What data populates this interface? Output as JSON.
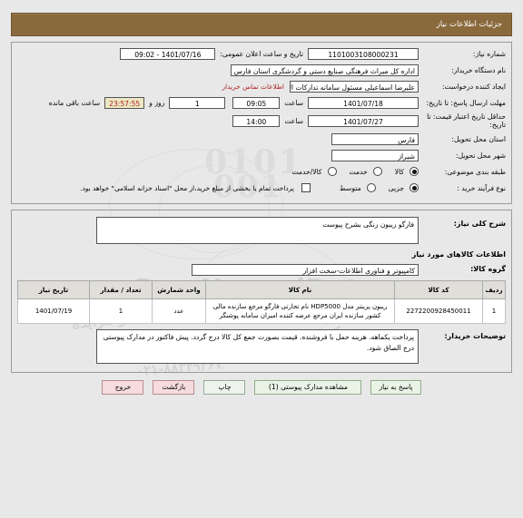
{
  "header": {
    "title": "جزئیات اطلاعات نیاز",
    "bar_color": "#8a6a3d"
  },
  "form": {
    "need_number_label": "شماره نیاز:",
    "need_number_value": "1101003108000231",
    "public_announce_label": "تاریخ و ساعت اعلان عمومی:",
    "public_announce_value": "1401/07/16 - 09:02",
    "buyer_org_label": "نام دستگاه خریدار:",
    "buyer_org_value": "اداره کل میراث فرهنگی  صنایع دستی و گردشگری استان فارس",
    "creator_label": "ایجاد کننده درخواست:",
    "creator_value": "علیرضا اسماعیلی مسئول سامانه تدارکات الکترونیکی اداره کل میراث فرهنگی",
    "contact_link": "اطلاعات تماس خریدار",
    "deadline_label": "مهلت ارسال پاسخ: تا تاریخ:",
    "deadline_date": "1401/07/18",
    "hour_label": "ساعت",
    "deadline_time": "09:05",
    "days_value": "1",
    "days_label": "روز و",
    "countdown_value": "23:57:55",
    "countdown_label": "ساعت باقی مانده",
    "validity_label": "حداقل تاریخ اعتبار قیمت: تا تاریخ:",
    "validity_date": "1401/07/27",
    "validity_time": "14:00",
    "province_label": "استان محل تحویل:",
    "province_value": "فارس",
    "city_label": "شهر محل تحویل:",
    "city_value": "شیراز",
    "classification_label": "طبقه بندی موضوعی:",
    "classification_options": [
      "کالا",
      "خدمت",
      "کالا/خدمت"
    ],
    "classification_selected": "کالا",
    "process_label": "نوع فرآیند خرید :",
    "process_options": [
      "جزیی",
      "متوسط"
    ],
    "process_selected": "جزیی",
    "treasury_checkbox_label": "پرداخت تمام یا بخشی از مبلغ خرید،از محل \"اسناد خزانه اسلامی\" خواهد بود.",
    "treasury_checked": false
  },
  "description": {
    "label": "شرح کلی نیاز:",
    "value": "فارگو ریبون رنگی بشرح پیوست"
  },
  "goods": {
    "section_title": "اطلاعات کالاهای مورد نیاز",
    "group_label": "گروه کالا:",
    "group_value": "کامپیوتر و فناوری اطلاعات-سخت افزار",
    "columns": [
      "ردیف",
      "کد کالا",
      "نام کالا",
      "واحد شمارش",
      "تعداد / مقدار",
      "تاریخ نیاز"
    ],
    "rows": [
      {
        "index": "1",
        "code": "2272200928450011",
        "name": "ریبون پرینتر مدل HDP5000 نام تجارتی فارگو مرجع سازنده مالی کشور سازنده ایران مرجع عرضه کننده امیران سامانه پوشنگر",
        "unit": "عدد",
        "qty": "1",
        "date": "1401/07/19"
      }
    ]
  },
  "buyer_notes": {
    "label": "توضیحات خریدار:",
    "value": "پرداخت یکماهه. هزینه حمل با فروشنده. قیمت بصورت جمع کل کالا درج گردد. پیش فاکتور در مدارک پیوستی درج الصاق شود."
  },
  "buttons": [
    {
      "id": "respond",
      "label": "پاسخ به نیاز",
      "style": "green"
    },
    {
      "id": "view-attachments",
      "label": "مشاهده مدارک پیوستی (1)",
      "style": "green"
    },
    {
      "id": "print",
      "label": "چاپ",
      "style": "plain"
    },
    {
      "id": "back",
      "label": "بازگشت",
      "style": "pink"
    },
    {
      "id": "exit",
      "label": "خروج",
      "style": "pink"
    }
  ],
  "watermark": {
    "brand": "ParsNamadData",
    "line1": "پایگاه اطلاع رسانی مناقصه و مزایده",
    "line2": "۰۲۱-۸۸۳۴۹۴۶۷",
    "line3": "مرکز فراوری اطلاعات پارس نماد داده ها"
  }
}
